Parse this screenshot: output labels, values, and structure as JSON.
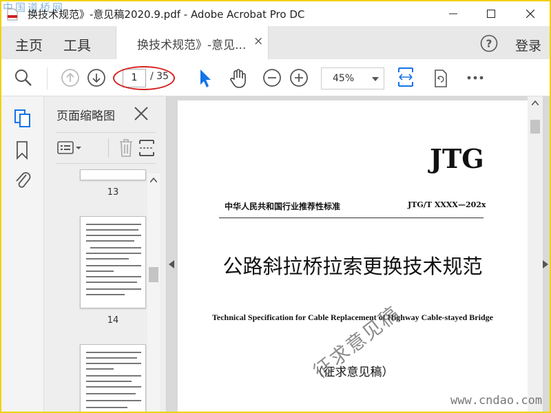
{
  "window": {
    "title": "换技术规范》-意见稿2020.9.pdf - Adobe Acrobat Pro DC",
    "watermark_top": "中国道桥网",
    "watermark_bottom": "www.cndao.com"
  },
  "tabs": {
    "home": "主页",
    "tools": "工具",
    "document": "换技术规范》-意见...",
    "document_close": "×",
    "login": "登录"
  },
  "toolbar": {
    "current_page": "1",
    "total_pages": "/ 35",
    "zoom": "45%"
  },
  "thumbnails": {
    "title": "页面缩略图",
    "pages": [
      {
        "number": "13"
      },
      {
        "number": "14"
      }
    ]
  },
  "document": {
    "code": "JTG",
    "standard_type": "中华人民共和国行业推荐性标准",
    "standard_number": "JTG/T XXXX—202x",
    "title": "公路斜拉桥拉索更换技术规范",
    "english_title": "Technical Specification for Cable Replacement of Highway Cable-stayed Bridge",
    "draft_label": "（征求意见稿）",
    "stamp": "征求意见稿"
  },
  "colors": {
    "accent_blue": "#1473e6",
    "annotation_red": "#d61f1f",
    "frame_yellow": "#f0d200"
  }
}
